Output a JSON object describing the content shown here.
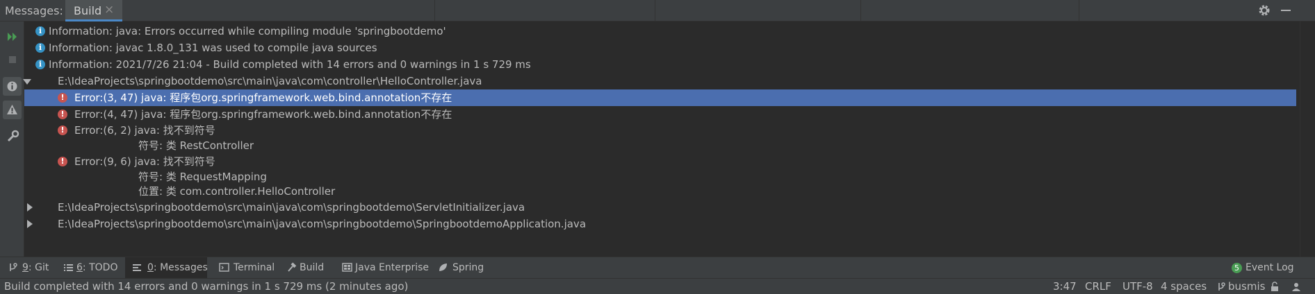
{
  "topbar": {
    "title": "Messages:",
    "tab_label": "Build",
    "tab_close": "×"
  },
  "messages": {
    "info_lines": [
      "Information: java: Errors occurred while compiling module 'springbootdemo'",
      "Information: javac 1.8.0_131 was used to compile java sources",
      "Information: 2021/7/26 21:04 - Build completed with 14 errors and 0 warnings in 1 s 729 ms"
    ],
    "files": [
      "E:\\IdeaProjects\\springbootdemo\\src\\main\\java\\com\\controller\\HelloController.java",
      "E:\\IdeaProjects\\springbootdemo\\src\\main\\java\\com\\springbootdemo\\ServletInitializer.java",
      "E:\\IdeaProjects\\springbootdemo\\src\\main\\java\\com\\springbootdemo\\SpringbootdemoApplication.java"
    ],
    "errors": [
      "Error:(3, 47)  java: 程序包org.springframework.web.bind.annotation不存在",
      "Error:(4, 47)  java: 程序包org.springframework.web.bind.annotation不存在",
      "Error:(6, 2)  java: 找不到符号",
      "Error:(9, 6)  java: 找不到符号"
    ],
    "details": [
      "符号: 类 RestController",
      "符号:  类 RequestMapping",
      "位置: 类 com.controller.HelloController"
    ]
  },
  "toolwindows": [
    {
      "mnemonic": "9",
      "label": ": Git"
    },
    {
      "mnemonic": "6",
      "label": ": TODO"
    },
    {
      "mnemonic": "0",
      "label": ": Messages"
    },
    {
      "mnemonic": "",
      "label": "Terminal"
    },
    {
      "mnemonic": "",
      "label": "Build"
    },
    {
      "mnemonic": "",
      "label": "Java Enterprise"
    },
    {
      "mnemonic": "",
      "label": "Spring"
    }
  ],
  "event_log": {
    "count": "5",
    "label": "Event Log"
  },
  "status": {
    "message": "Build completed with 14 errors and 0 warnings in 1 s 729 ms (2 minutes ago)",
    "position": "3:47",
    "line_sep": "CRLF",
    "encoding": "UTF-8",
    "indent": "4 spaces",
    "branch": "busmis"
  },
  "colors": {
    "selection": "#4b6eaf",
    "error": "#c75450",
    "info": "#3592c4",
    "run": "#499c54"
  }
}
